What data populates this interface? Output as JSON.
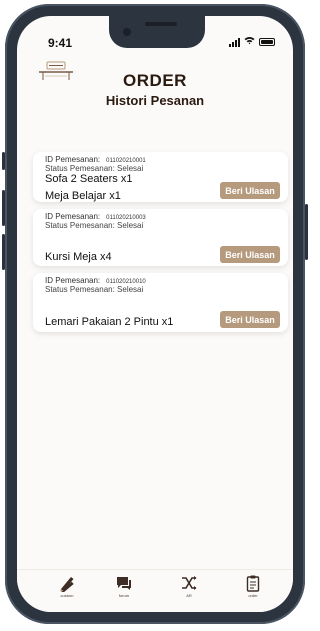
{
  "status_bar": {
    "time": "9:41"
  },
  "header": {
    "title": "ORDER",
    "subtitle": "Histori Pesanan"
  },
  "orders": [
    {
      "id_label": "ID Pemesanan:",
      "id_value": "011020210001",
      "status": "Status Pemesanan: Selesai",
      "items": [
        "Sofa 2 Seaters x1",
        "Meja Belajar x1"
      ],
      "button": "Beri Ulasan"
    },
    {
      "id_label": "ID Pemesanan:",
      "id_value": "011020210003",
      "status": "Status Pemesanan: Selesai",
      "items": [
        "Kursi Meja x4"
      ],
      "button": "Beri Ulasan"
    },
    {
      "id_label": "ID Pemesanan:",
      "id_value": "011020210010",
      "status": "Status Pemesanan: Selesai",
      "items": [
        "Lemari Pakaian 2 Pintu x1"
      ],
      "button": "Beri Ulasan"
    }
  ],
  "bottom_nav": [
    {
      "icon": "pencil-ruler-icon",
      "label": "custom"
    },
    {
      "icon": "chat-icon",
      "label": "forum"
    },
    {
      "icon": "shuffle-icon",
      "label": "AR"
    },
    {
      "icon": "clipboard-icon",
      "label": "order"
    }
  ],
  "colors": {
    "accent": "#b59a7d",
    "text_dark": "#2a1a10",
    "frame": "#2c3440"
  }
}
